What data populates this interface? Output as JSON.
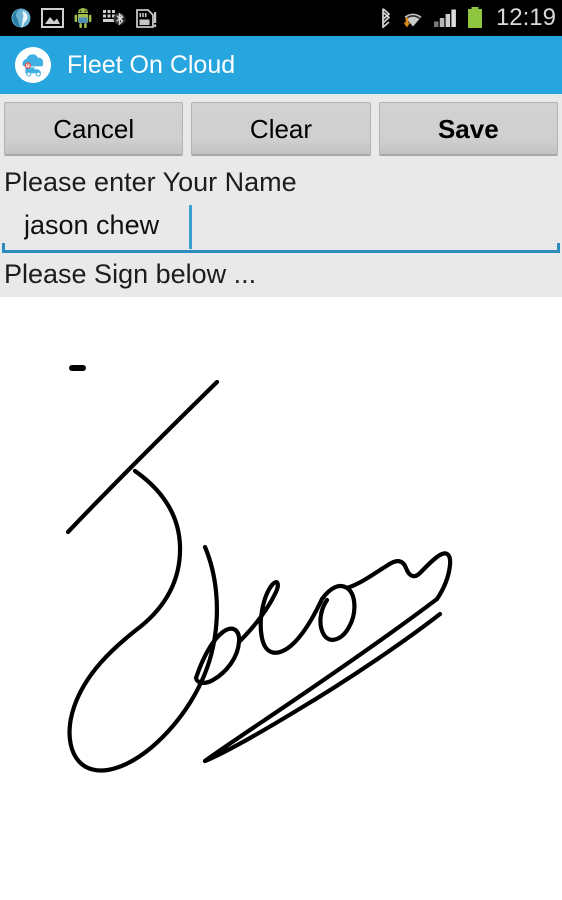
{
  "status_bar": {
    "background_color": "#000000",
    "time": "12:19",
    "left_icons": [
      {
        "name": "browser-icon",
        "label": "Browser"
      },
      {
        "name": "gallery-image-icon",
        "label": "Gallery"
      },
      {
        "name": "android-robot-icon",
        "label": "Android system"
      },
      {
        "name": "bluetooth-keyboard-icon",
        "label": "Bluetooth keyboard"
      },
      {
        "name": "sd-card-icon",
        "label": "SD card"
      }
    ],
    "right_icons": [
      {
        "name": "bluetooth-icon",
        "label": "Bluetooth"
      },
      {
        "name": "wifi-icon",
        "label": "Wi-Fi with data transfer"
      },
      {
        "name": "cellular-signal-icon",
        "label": "Cellular signal"
      },
      {
        "name": "battery-icon",
        "label": "Battery full",
        "color": "#8ec63f"
      }
    ]
  },
  "app_bar": {
    "title": "Fleet On Cloud",
    "background_color": "#27a5de",
    "title_color": "#ffffff",
    "logo_name": "fleet-on-cloud-logo"
  },
  "toolbar": {
    "cancel_label": "Cancel",
    "clear_label": "Clear",
    "save_label": "Save"
  },
  "form": {
    "background_color": "#e9e9e9",
    "name_label": "Please enter Your Name",
    "name_value": "jason chew",
    "name_placeholder": "",
    "sign_label": "Please Sign below ...",
    "accent_color": "#2d8cbb"
  },
  "signature": {
    "name": "signature-canvas",
    "background_color": "#ffffff",
    "ink_color": "#000000",
    "has_signature": true
  }
}
